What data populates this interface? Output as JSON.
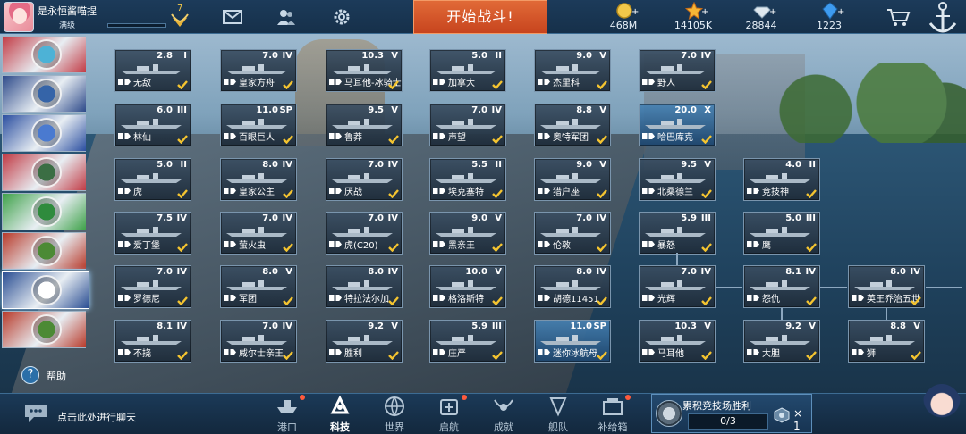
{
  "top_bar": {
    "player_name": "是永恒酱喵捏",
    "player_level_label": "满级",
    "rank_number": "7",
    "start_battle_label": "开始战斗!",
    "resources": [
      {
        "icon": "gold-coin-icon",
        "value": "468M",
        "color": "#f2c84a"
      },
      {
        "icon": "star-icon",
        "value": "14105K",
        "color": "#f5b536"
      },
      {
        "icon": "diamond-icon",
        "value": "28844",
        "color": "#dfe8ef"
      },
      {
        "icon": "blue-gem-icon",
        "value": "1223",
        "color": "#3d9bf0"
      }
    ],
    "plus_label": "+"
  },
  "nations": [
    {
      "name": "nation-tab-1",
      "bg": "#c23b45",
      "emblem": "#4db2d6"
    },
    {
      "name": "nation-tab-2",
      "bg": "#2d4a8a",
      "emblem": "#3564a8"
    },
    {
      "name": "nation-tab-3",
      "bg": "#2a4ea0",
      "emblem": "#4a7ad0"
    },
    {
      "name": "nation-tab-4",
      "bg": "#c23b45",
      "emblem": "#3b6e44"
    },
    {
      "name": "nation-tab-5",
      "bg": "#3fa24a",
      "emblem": "#2f8b3d"
    },
    {
      "name": "nation-tab-6",
      "bg": "#b83a2a",
      "emblem": "#4c8a35"
    },
    {
      "name": "nation-tab-7",
      "bg": "#2a4e93",
      "emblem": "#ffffff",
      "active": true
    },
    {
      "name": "nation-tab-8",
      "bg": "#b83a2a",
      "emblem": "#4c8a35"
    }
  ],
  "help_label": "帮助",
  "ships": [
    {
      "name": "无敌",
      "level": "2.8",
      "tier": "I"
    },
    {
      "name": "皇家方舟",
      "level": "7.0",
      "tier": "IV"
    },
    {
      "name": "马耳他-冰骑士",
      "level": "10.3",
      "tier": "V"
    },
    {
      "name": "加拿大",
      "level": "5.0",
      "tier": "II"
    },
    {
      "name": "杰里科",
      "level": "9.0",
      "tier": "V"
    },
    {
      "name": "野人",
      "level": "7.0",
      "tier": "IV"
    },
    {
      "name": "林仙",
      "level": "6.0",
      "tier": "III"
    },
    {
      "name": "百眼巨人",
      "level": "11.0",
      "tier": "SP"
    },
    {
      "name": "鲁莽",
      "level": "9.5",
      "tier": "V"
    },
    {
      "name": "声望",
      "level": "7.0",
      "tier": "IV"
    },
    {
      "name": "奥特军团",
      "level": "8.8",
      "tier": "V"
    },
    {
      "name": "哈巴库克",
      "level": "20.0",
      "tier": "X"
    },
    {
      "name": "虎",
      "level": "5.0",
      "tier": "II"
    },
    {
      "name": "皇家公主",
      "level": "8.0",
      "tier": "IV"
    },
    {
      "name": "厌战",
      "level": "7.0",
      "tier": "IV"
    },
    {
      "name": "埃克塞特",
      "level": "5.5",
      "tier": "II"
    },
    {
      "name": "猎户座",
      "level": "9.0",
      "tier": "V"
    },
    {
      "name": "北桑德兰",
      "level": "9.5",
      "tier": "V"
    },
    {
      "name": "竞技神",
      "level": "4.0",
      "tier": "II"
    },
    {
      "name": "爱丁堡",
      "level": "7.5",
      "tier": "IV"
    },
    {
      "name": "萤火虫",
      "level": "7.0",
      "tier": "IV"
    },
    {
      "name": "虎(C20)",
      "level": "7.0",
      "tier": "IV"
    },
    {
      "name": "黑亲王",
      "level": "9.0",
      "tier": "V"
    },
    {
      "name": "伦敦",
      "level": "7.0",
      "tier": "IV"
    },
    {
      "name": "暴怒",
      "level": "5.9",
      "tier": "III"
    },
    {
      "name": "鹰",
      "level": "5.0",
      "tier": "III"
    },
    {
      "name": "罗德尼",
      "level": "7.0",
      "tier": "IV"
    },
    {
      "name": "军团",
      "level": "8.0",
      "tier": "V"
    },
    {
      "name": "特拉法尔加",
      "level": "8.0",
      "tier": "IV"
    },
    {
      "name": "格洛斯特",
      "level": "10.0",
      "tier": "V"
    },
    {
      "name": "胡德11451",
      "level": "8.0",
      "tier": "IV"
    },
    {
      "name": "光辉",
      "level": "7.0",
      "tier": "IV"
    },
    {
      "name": "怨仇",
      "level": "8.1",
      "tier": "IV"
    },
    {
      "name": "英王乔治五世",
      "level": "8.0",
      "tier": "IV"
    },
    {
      "name": "不挠",
      "level": "8.1",
      "tier": "IV"
    },
    {
      "name": "威尔士亲王",
      "level": "7.0",
      "tier": "IV"
    },
    {
      "name": "胜利",
      "level": "9.2",
      "tier": "V"
    },
    {
      "name": "庄严",
      "level": "5.9",
      "tier": "III"
    },
    {
      "name": "迷你冰航母",
      "level": "11.0",
      "tier": "SP"
    },
    {
      "name": "马耳他",
      "level": "10.3",
      "tier": "V"
    },
    {
      "name": "大胆",
      "level": "9.2",
      "tier": "V"
    },
    {
      "name": "狮",
      "level": "8.8",
      "tier": "V"
    }
  ],
  "bottom_bar": {
    "chat_placeholder": "点击此处进行聊天",
    "nav": [
      {
        "label": "港口",
        "icon": "port-icon"
      },
      {
        "label": "科技",
        "icon": "tech-icon",
        "active": true
      },
      {
        "label": "世界",
        "icon": "world-icon"
      },
      {
        "label": "启航",
        "icon": "launch-icon"
      },
      {
        "label": "成就",
        "icon": "achievement-icon"
      },
      {
        "label": "舰队",
        "icon": "fleet-icon"
      },
      {
        "label": "补给箱",
        "icon": "supply-box-icon"
      }
    ],
    "arena": {
      "title": "累积竞技场胜利",
      "progress": "0/3",
      "reward_count": "× 1"
    }
  }
}
